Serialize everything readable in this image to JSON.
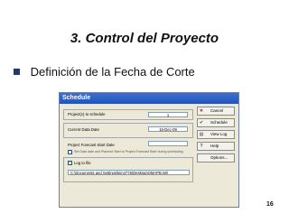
{
  "slide": {
    "title": "3. Control del Proyecto",
    "bullet": "Definición de la Fecha de Corte",
    "page_number": "16"
  },
  "dialog": {
    "title": "Schedule",
    "projects_label": "Project(s) to schedule",
    "projects_value": "1",
    "current_date_label": "Current Data Date",
    "current_date_value": "15-Dec-09",
    "forecast_label": "Project Forecast Start Date",
    "forecast_value": "",
    "checkbox1_label": "Set Data date and Planned Start to Project Forecast Start during scheduling",
    "checkbox1_checked": false,
    "log_label": "Log to file",
    "log_checked": true,
    "log_path": "C:\\Documents and Settings\\kim4776\\Desktop\\OMAPB.Wri"
  },
  "buttons": {
    "cancel": "Cancel",
    "schedule": "Schedule",
    "view_log": "View Log",
    "help": "Help",
    "options": "Options..."
  },
  "icons": {
    "cancel": "x-icon",
    "schedule": "green-check-icon",
    "view_log": "document-icon",
    "help": "question-icon"
  }
}
